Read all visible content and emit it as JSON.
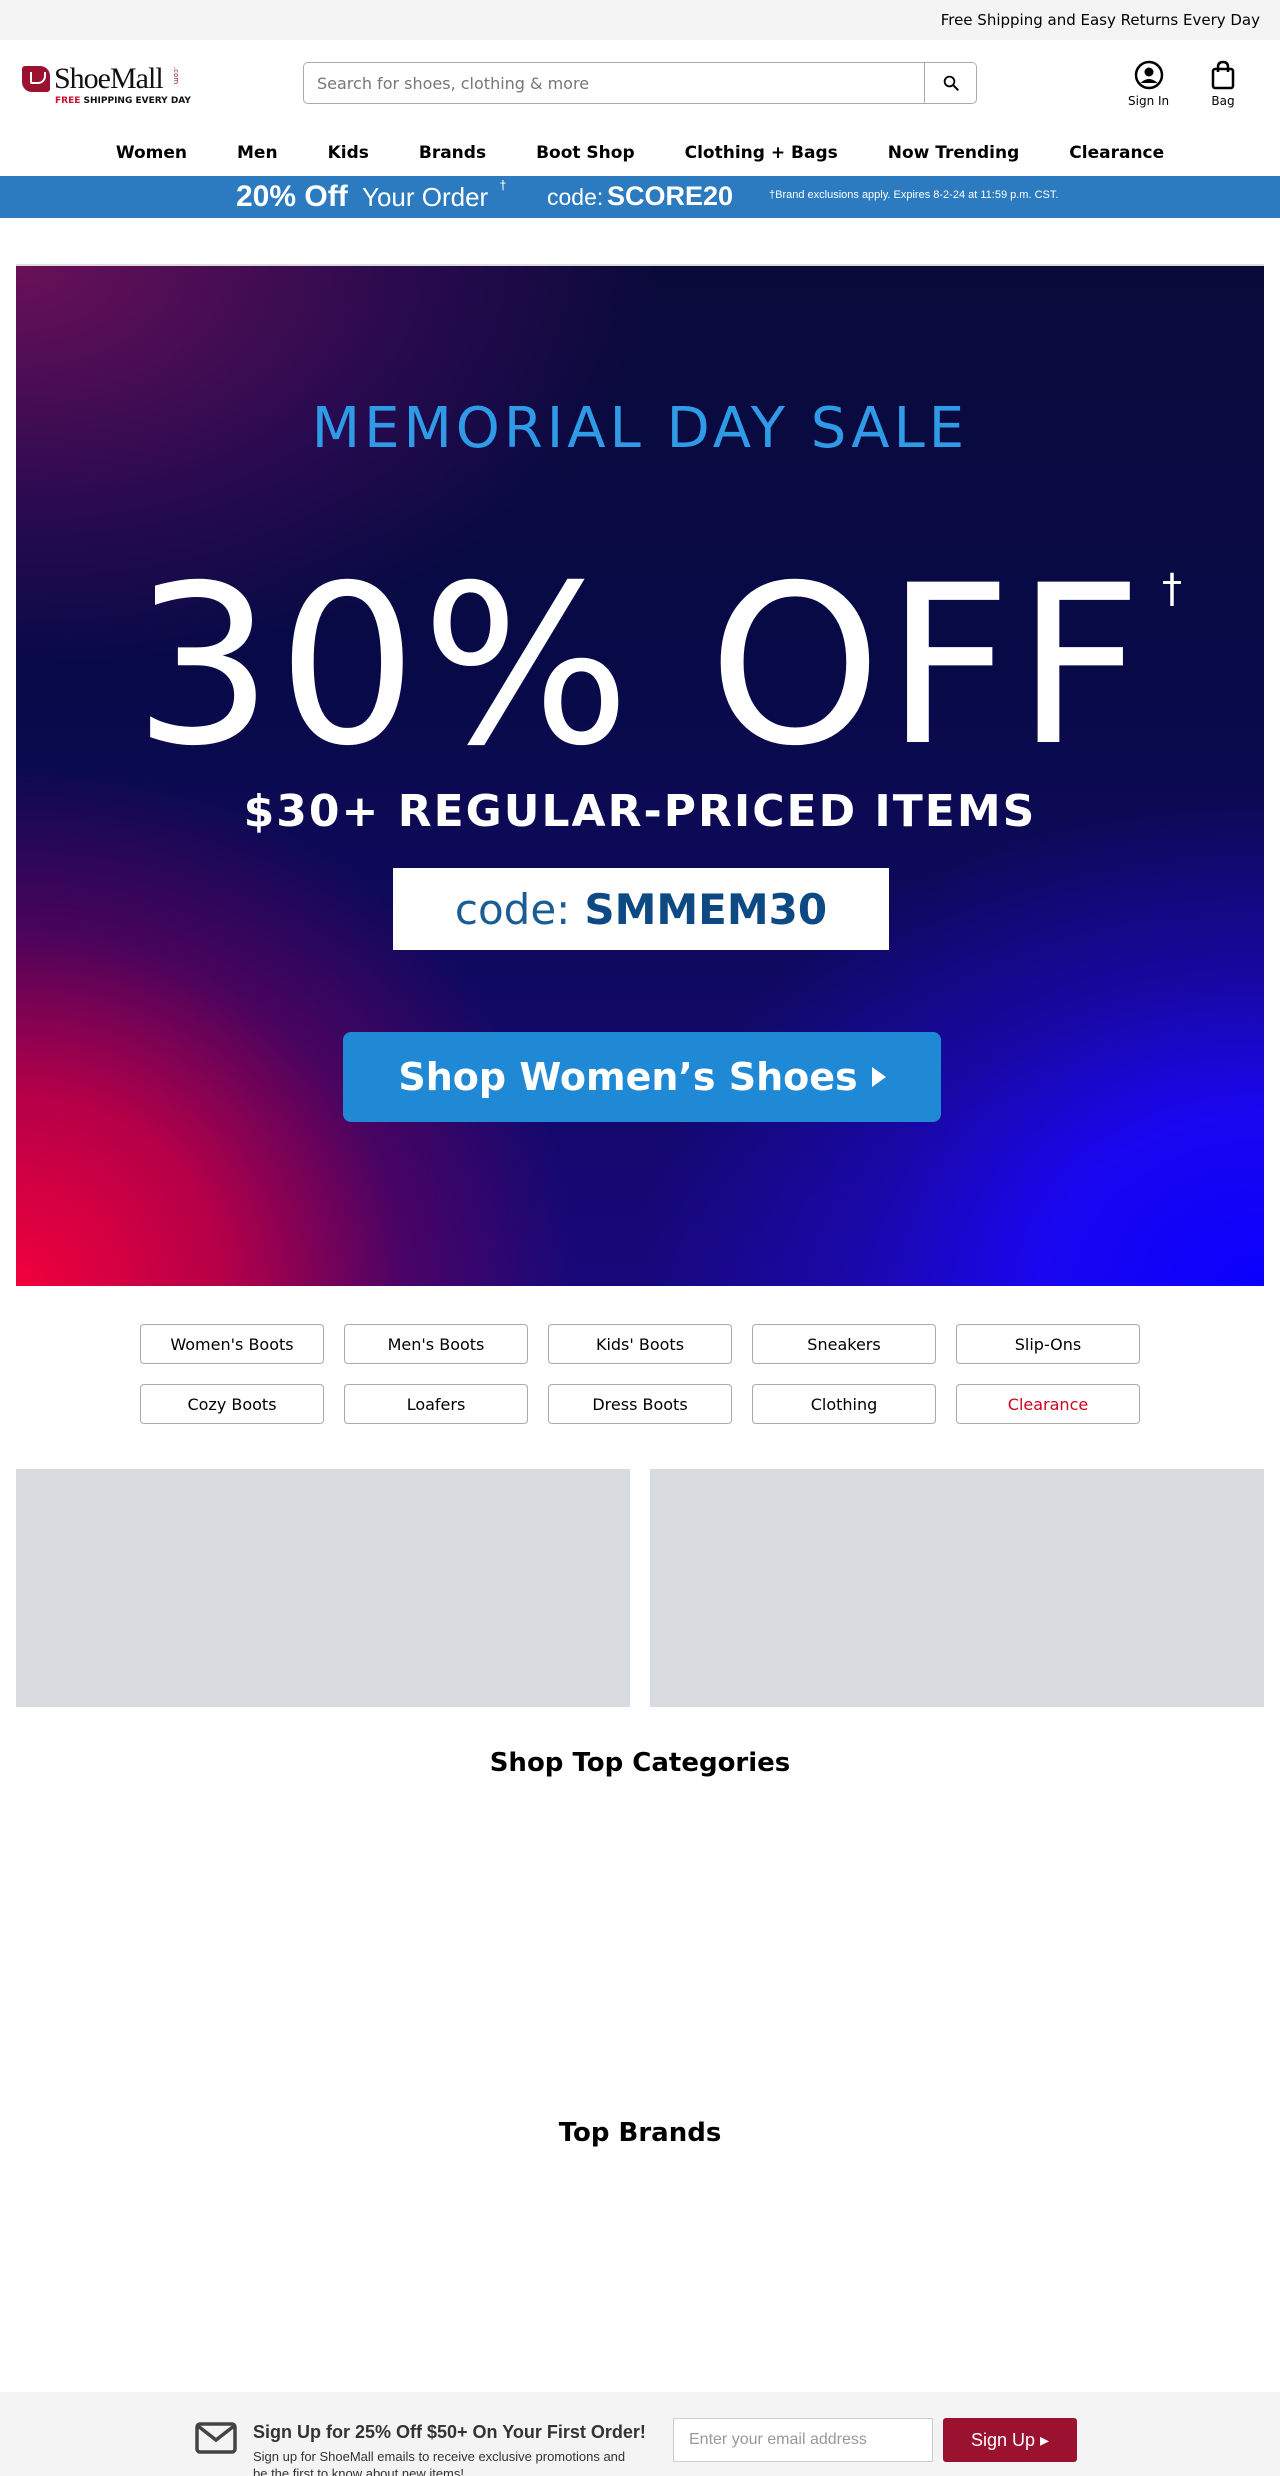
{
  "topbar": {
    "text": "Free Shipping and Easy Returns Every Day"
  },
  "logo": {
    "name": "ShoeMall",
    "dotcom": ".com",
    "tagline_free": "FREE",
    "tagline_rest": " SHIPPING EVERY DAY"
  },
  "search": {
    "placeholder": "Search for shoes, clothing & more"
  },
  "header": {
    "signin_label": "Sign In",
    "bag_label": "Bag"
  },
  "nav": {
    "items": [
      "Women",
      "Men",
      "Kids",
      "Brands",
      "Boot Shop",
      "Clothing + Bags",
      "Now Trending",
      "Clearance"
    ]
  },
  "promo": {
    "amount": "20% Off",
    "suffix": "Your Order",
    "dagger": "†",
    "code_label": "code:",
    "code": "SCORE20",
    "disclaimer": "†Brand exclusions apply. Expires 8-2-24 at 11:59 p.m. CST."
  },
  "hero": {
    "title": "MEMORIAL DAY SALE",
    "big": "30% OFF",
    "dagger": "†",
    "sub": "$30+ REGULAR-PRICED ITEMS",
    "code_label": "code:",
    "code": "SMMEM30",
    "button": "Shop Women’s Shoes",
    "colors": {
      "title": "#2f9be6",
      "button": "#2089d6",
      "code": "#0d4a84"
    }
  },
  "categories": [
    "Women's Boots",
    "Men's Boots",
    "Kids' Boots",
    "Sneakers",
    "Slip-Ons",
    "Cozy Boots",
    "Loafers",
    "Dress Boots",
    "Clothing",
    "Clearance"
  ],
  "sections": {
    "top_categories": "Shop Top Categories",
    "top_brands": "Top Brands"
  },
  "signup": {
    "title": "Sign Up for 25% Off $50+ On Your First Order!",
    "text": "Sign up for ShoeMall emails to receive exclusive promotions and be the first to know about new items!",
    "placeholder": "Enter your email address",
    "button": "Sign Up ▸",
    "button_color": "#9b1230"
  }
}
